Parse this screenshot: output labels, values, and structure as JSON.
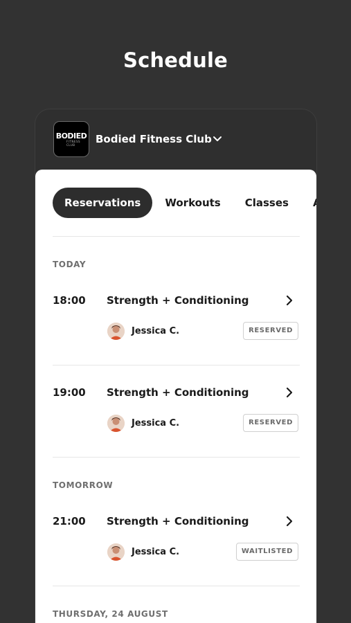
{
  "page": {
    "title": "Schedule"
  },
  "club": {
    "name": "Bodied Fitness Club",
    "logo_main": "BODIED",
    "logo_sub": "FITNESS CLUB"
  },
  "tabs": [
    {
      "label": "Reservations",
      "active": true
    },
    {
      "label": "Workouts",
      "active": false
    },
    {
      "label": "Classes",
      "active": false
    },
    {
      "label": "Ap",
      "active": false
    }
  ],
  "sections": [
    {
      "label": "TODAY",
      "entries": [
        {
          "time": "18:00",
          "title": "Strength + Conditioning",
          "coach": "Jessica C.",
          "status": "RESERVED"
        },
        {
          "time": "19:00",
          "title": "Strength + Conditioning",
          "coach": "Jessica C.",
          "status": "RESERVED"
        }
      ]
    },
    {
      "label": "TOMORROW",
      "entries": [
        {
          "time": "21:00",
          "title": "Strength + Conditioning",
          "coach": "Jessica C.",
          "status": "WAITLISTED"
        }
      ]
    },
    {
      "label": "THURSDAY, 24 AUGUST",
      "entries": []
    }
  ],
  "colors": {
    "background": "#323232",
    "card": "#ffffff",
    "active_tab": "#2d2d2d"
  }
}
